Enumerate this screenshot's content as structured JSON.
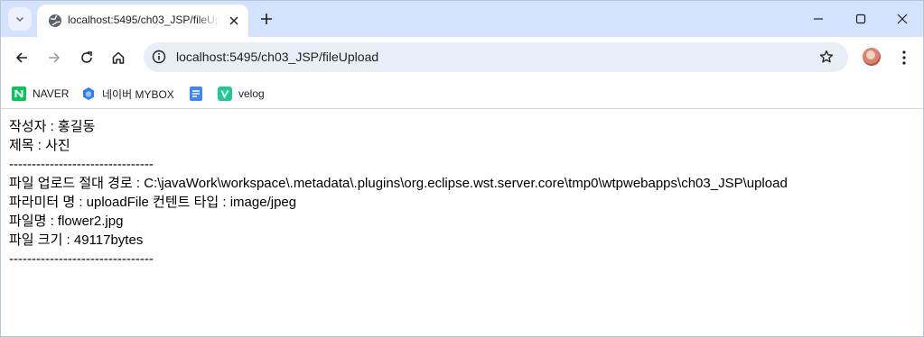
{
  "tab": {
    "title": "localhost:5495/ch03_JSP/fileUpload",
    "favicon": "globe-icon"
  },
  "toolbar": {
    "url": "localhost:5495/ch03_JSP/fileUpload"
  },
  "bookmarks": [
    {
      "label": "NAVER",
      "icon": "naver-icon",
      "color": "#03c75a"
    },
    {
      "label": "네이버 MYBOX",
      "icon": "mybox-icon",
      "color": "#2f7cf6"
    },
    {
      "label": "",
      "icon": "docs-icon",
      "color": "#4285f4"
    },
    {
      "label": "velog",
      "icon": "velog-icon",
      "color": "#20c997"
    }
  ],
  "content": {
    "lines": [
      "작성자 : 홍길동",
      "제목 : 사진",
      "--------------------------------",
      "파일 업로드 절대 경로 : C:\\javaWork\\workspace\\.metadata\\.plugins\\org.eclipse.wst.server.core\\tmp0\\wtpwebapps\\ch03_JSP\\upload",
      "파라미터 명 : uploadFile 컨텐트 타입 : image/jpeg",
      "파일명 : flower2.jpg",
      "파일 크기 : 49117bytes",
      "--------------------------------"
    ]
  }
}
